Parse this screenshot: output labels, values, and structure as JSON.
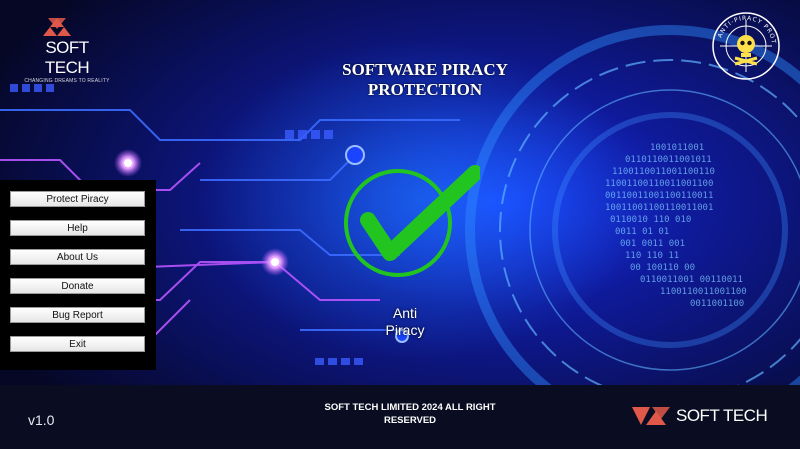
{
  "app": {
    "brand": "SOFT TECH",
    "tagline": "CHANGING DREAMS TO REALITY",
    "title_line1": "SOFTWARE PIRACY",
    "title_line2": "PROTECTION",
    "badge_text": "ANTI-PIRACY PROTECTION"
  },
  "menu": {
    "items": [
      {
        "label": "Protect Piracy"
      },
      {
        "label": "Help"
      },
      {
        "label": "About Us"
      },
      {
        "label": "Donate"
      },
      {
        "label": "Bug Report"
      },
      {
        "label": "Exit"
      }
    ]
  },
  "status": {
    "line1": "Anti",
    "line2": "Piracy"
  },
  "footer": {
    "version": "v1.0",
    "copyright_line1": "SOFT TECH LIMITED 2024 ALL RIGHT",
    "copyright_line2": "RESERVED",
    "brand": "SOFT TECH"
  },
  "colors": {
    "accent_check": "#22c51f",
    "circuit_purple": "#b855ff",
    "circuit_blue": "#3a6bff",
    "logo_red": "#e0584a"
  }
}
